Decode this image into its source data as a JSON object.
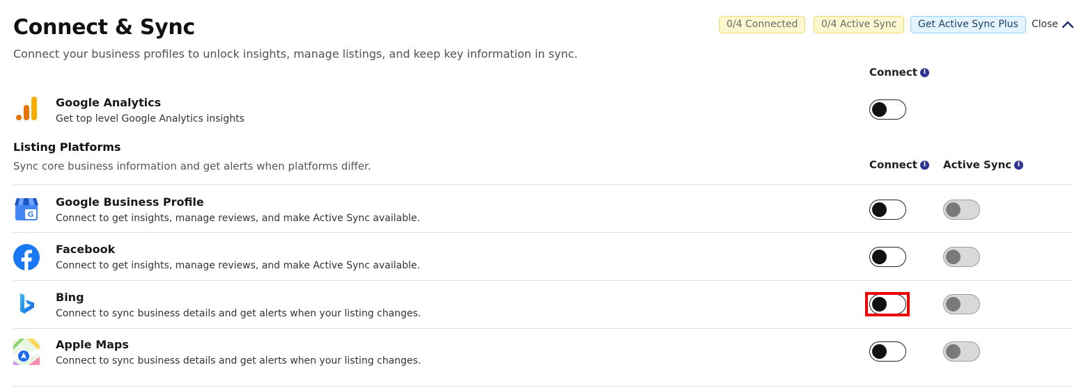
{
  "header": {
    "title": "Connect & Sync",
    "subtitle": "Connect your business profiles to unlock insights, manage listings, and keep key information in sync.",
    "badges": {
      "connected": "0/4 Connected",
      "active_sync": "0/4 Active Sync",
      "plus": "Get Active Sync Plus"
    },
    "close_label": "Close"
  },
  "analytics": {
    "connect_header": "Connect",
    "item": {
      "name": "Google Analytics",
      "description": "Get top level Google Analytics insights",
      "icon": "google-analytics-icon",
      "connect": false
    }
  },
  "listing": {
    "title": "Listing Platforms",
    "subtitle": "Sync core business information and get alerts when platforms differ.",
    "connect_header": "Connect",
    "active_sync_header": "Active Sync",
    "items": [
      {
        "name": "Google Business Profile",
        "description": "Connect to get insights, manage reviews, and make Active Sync available.",
        "icon": "google-business-profile-icon",
        "connect": false,
        "active_sync": false,
        "active_sync_disabled": true
      },
      {
        "name": "Facebook",
        "description": "Connect to get insights, manage reviews, and make Active Sync available.",
        "icon": "facebook-icon",
        "connect": false,
        "active_sync": false,
        "active_sync_disabled": true
      },
      {
        "name": "Bing",
        "description": "Connect to sync business details and get alerts when your listing changes.",
        "icon": "bing-icon",
        "connect": false,
        "active_sync": false,
        "active_sync_disabled": true,
        "highlighted": true
      },
      {
        "name": "Apple Maps",
        "description": "Connect to sync business details and get alerts when your listing changes.",
        "icon": "apple-maps-icon",
        "connect": false,
        "active_sync": false,
        "active_sync_disabled": true
      }
    ]
  },
  "colors": {
    "info_icon": "#2d3493",
    "highlight": "#ee0000",
    "facebook": "#1877f2",
    "google_analytics_orange": "#f9ab00",
    "google_analytics_dark": "#e37400"
  }
}
